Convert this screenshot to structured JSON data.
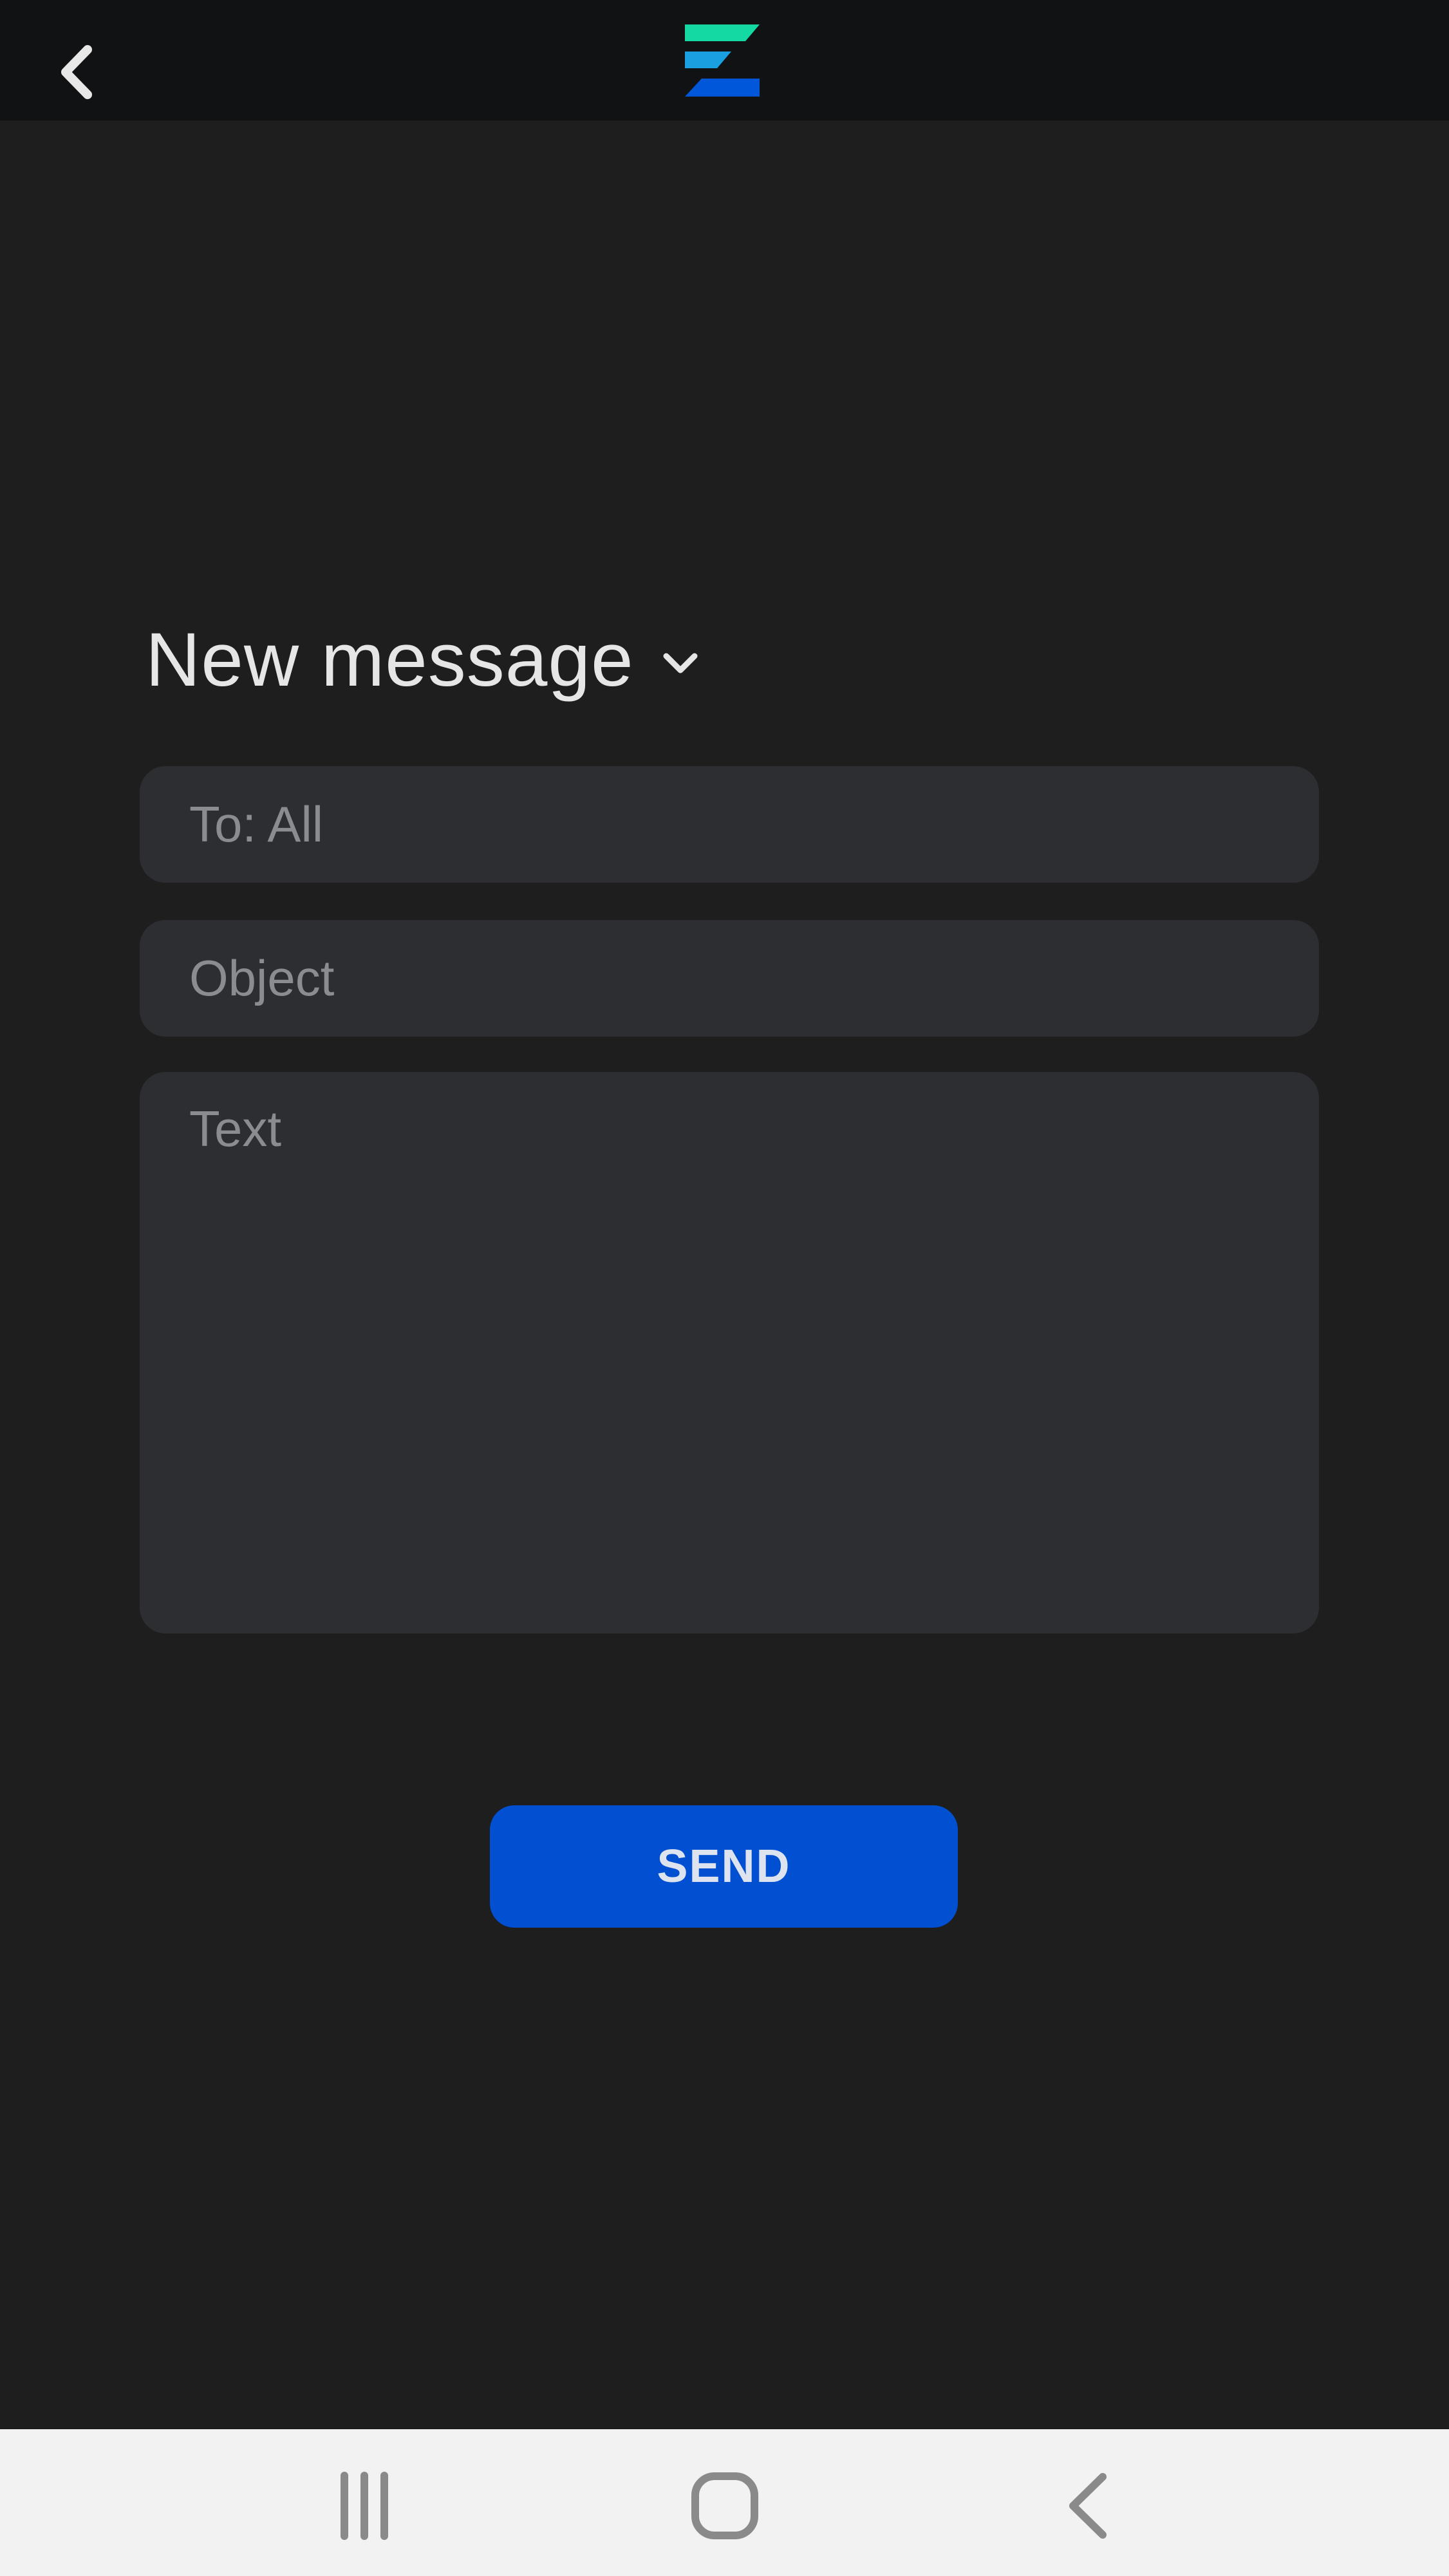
{
  "topbar": {
    "back_icon": "chevron-left-icon",
    "logo_icon": "app-logo-icon",
    "logo_colors": [
      "#14d9a3",
      "#1aa0e0",
      "#0057d9"
    ]
  },
  "compose": {
    "title": "New message",
    "title_icon": "chevron-down-icon",
    "to_placeholder": "To: All",
    "object_placeholder": "Object",
    "text_placeholder": "Text",
    "send_label": "SEND"
  },
  "navbar": {
    "recents_icon": "recents-icon",
    "home_icon": "home-icon",
    "back_icon": "back-icon"
  },
  "colors": {
    "background": "#1e1e1f",
    "topbar": "#111214",
    "field": "#2d2e32",
    "accent": "#0050d1",
    "navbar": "#f2f2f2"
  }
}
